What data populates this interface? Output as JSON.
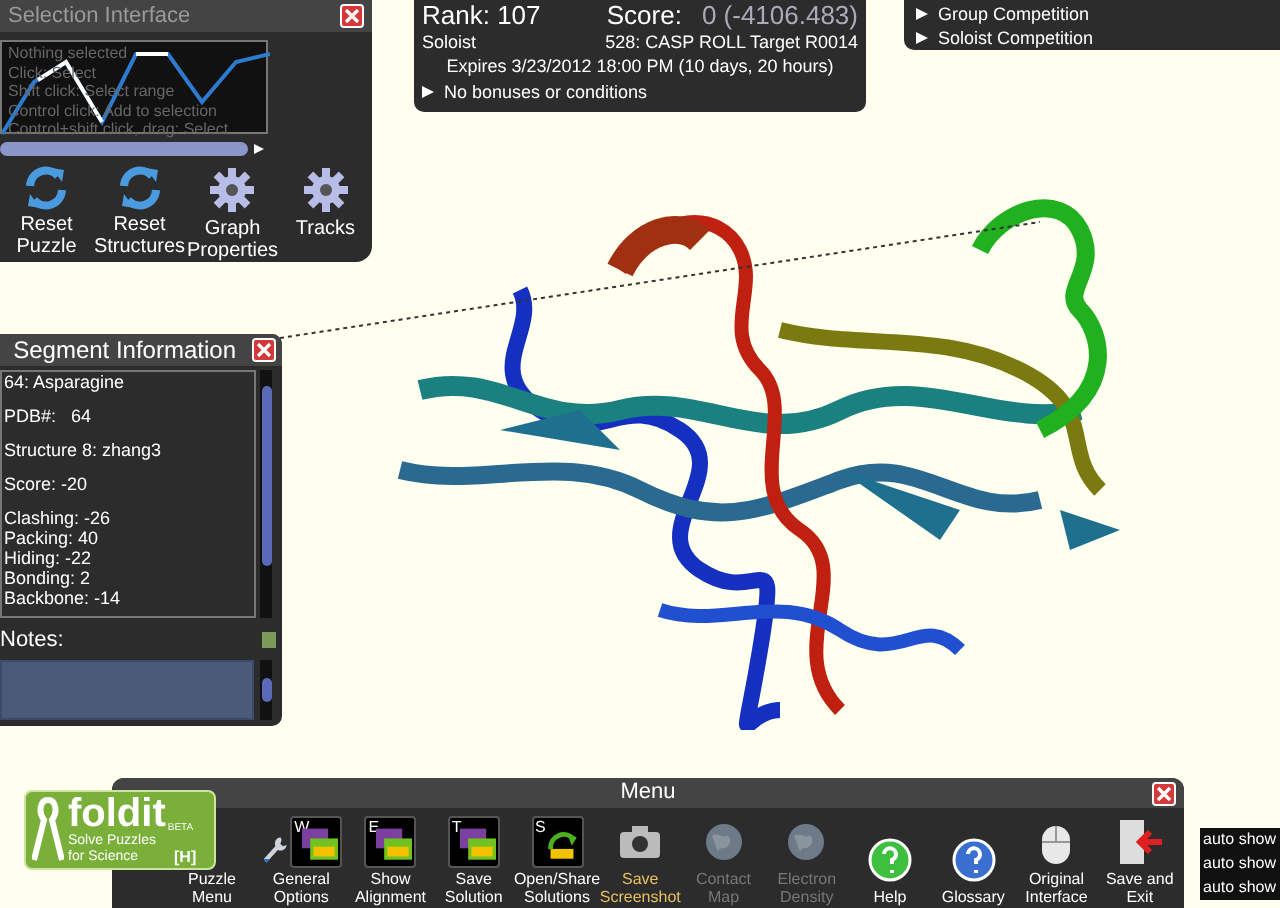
{
  "selection_interface": {
    "title": "Selection Interface",
    "hints": [
      "Nothing selected",
      "Click: Select",
      "Shift click: Select range",
      "Control click: Add to selection",
      "Control+shift click, drag: Select"
    ],
    "buttons": [
      {
        "label": "Reset Puzzle",
        "kind": "refresh"
      },
      {
        "label": "Reset Structures",
        "kind": "refresh"
      },
      {
        "label": "Graph Properties",
        "kind": "gear"
      },
      {
        "label": "Tracks",
        "kind": "gear"
      }
    ]
  },
  "score_panel": {
    "rank": "Rank: 107",
    "score_label": "Score:",
    "score": "0 (-4106.483)",
    "role": "Soloist",
    "puzzle": "528: CASP ROLL Target R0014",
    "expires": "Expires 3/23/2012 18:00 PM (10 days, 20 hours)",
    "bonuses": "No bonuses or conditions"
  },
  "competitions": [
    "Group Competition",
    "Soloist Competition"
  ],
  "segment_info": {
    "title": "Segment Information",
    "groups": [
      [
        "64: Asparagine"
      ],
      [
        "PDB#:   64"
      ],
      [
        "Structure 8: zhang3"
      ],
      [
        "Score: -20"
      ],
      [
        "Clashing: -26",
        "Packing: 40",
        "Hiding: -22",
        "Bonding: 2",
        "Backbone: -14"
      ]
    ],
    "notes_label": "Notes:"
  },
  "logo": {
    "name": "foldit",
    "tag": "BETA",
    "slogan": "Solve Puzzles for Science",
    "key": "[H]"
  },
  "menu": {
    "title": "Menu",
    "items": [
      {
        "label": "Puzzle Menu",
        "kind": "none",
        "enabled": true,
        "highlighted": false
      },
      {
        "label": "General Options",
        "kind": "wrench",
        "key": "W",
        "enabled": true,
        "highlighted": false
      },
      {
        "label": "Show Alignment",
        "kind": "all",
        "key": "E",
        "enabled": true,
        "highlighted": false
      },
      {
        "label": "Save Solution",
        "kind": "all",
        "key": "T",
        "enabled": true,
        "highlighted": false
      },
      {
        "label": "Open/Share Solutions",
        "kind": "share",
        "key": "S",
        "enabled": true,
        "highlighted": false
      },
      {
        "label": "Save Screenshot",
        "kind": "camera",
        "enabled": true,
        "highlighted": true
      },
      {
        "label": "Contact Map",
        "kind": "globe",
        "enabled": false,
        "highlighted": false
      },
      {
        "label": "Electron Density",
        "kind": "globe",
        "enabled": false,
        "highlighted": false
      },
      {
        "label": "Help",
        "kind": "help",
        "enabled": true,
        "highlighted": false
      },
      {
        "label": "Glossary",
        "kind": "glossary",
        "enabled": true,
        "highlighted": false
      },
      {
        "label": "Original Interface",
        "kind": "mouse",
        "enabled": true,
        "highlighted": false
      },
      {
        "label": "Save and Exit",
        "kind": "exit",
        "enabled": true,
        "highlighted": false
      }
    ]
  },
  "chat_rows": [
    "auto show",
    "auto show",
    "auto show"
  ]
}
